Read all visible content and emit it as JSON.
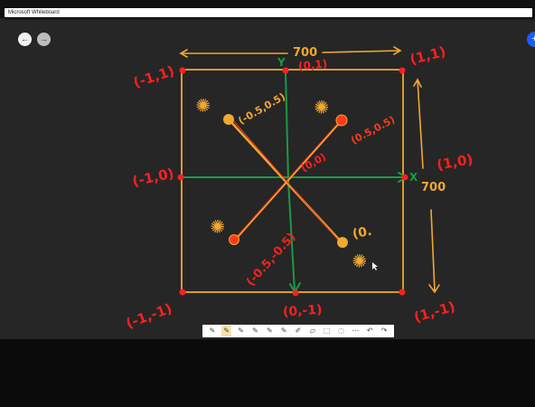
{
  "window": {
    "title": "Microsoft Whiteboard"
  },
  "nav": {
    "back_icon": "arrow-left-icon",
    "forward_icon": "arrow-right-icon",
    "back_glyph": "←",
    "forward_glyph": "→"
  },
  "fab": {
    "icon": "plus-icon",
    "glyph": "+"
  },
  "board": {
    "width_label": "700",
    "height_label": "700",
    "corner_labels": {
      "top_left": "(-1,1)",
      "top_center": "(0,1)",
      "top_right": "(1,1)",
      "middle_left": "(-1,0)",
      "middle_right": "(1,0)",
      "bottom_left": "(-1,-1)",
      "bottom_center": "(0,-1)",
      "bottom_right": "(1,-1)"
    },
    "center_label": "(0,0)",
    "point_labels": {
      "upper_left": "(-0.5,0.5)",
      "upper_right": "(0.5,0.5)",
      "lower_left": "(-0.5,-0.5)",
      "lower_right": "(0."
    },
    "axis_markers": {
      "y": "Y",
      "x": "X"
    },
    "light_glyph": "✺"
  },
  "toolbar": {
    "tools": [
      {
        "name": "pen-black-icon",
        "glyph": "✎"
      },
      {
        "name": "pen-yellow-icon",
        "glyph": "✎",
        "active": true
      },
      {
        "name": "pen-red-icon",
        "glyph": "✎"
      },
      {
        "name": "pen-gray-icon",
        "glyph": "✎"
      },
      {
        "name": "pen-white-icon",
        "glyph": "✎"
      },
      {
        "name": "pen-blue-icon",
        "glyph": "✎"
      },
      {
        "name": "highlighter-icon",
        "glyph": "✐"
      },
      {
        "name": "eraser-icon",
        "glyph": "▱"
      },
      {
        "name": "lasso-icon",
        "glyph": "⬚"
      },
      {
        "name": "ruler-icon",
        "glyph": "◌"
      },
      {
        "name": "more-icon",
        "glyph": "⋯"
      },
      {
        "name": "undo-icon",
        "glyph": "↶"
      },
      {
        "name": "redo-icon",
        "glyph": "↷"
      }
    ]
  },
  "colors": {
    "orange": "#f0a830",
    "red": "#ff2020",
    "green": "#1a9a46",
    "blue": "#1a5cff"
  }
}
